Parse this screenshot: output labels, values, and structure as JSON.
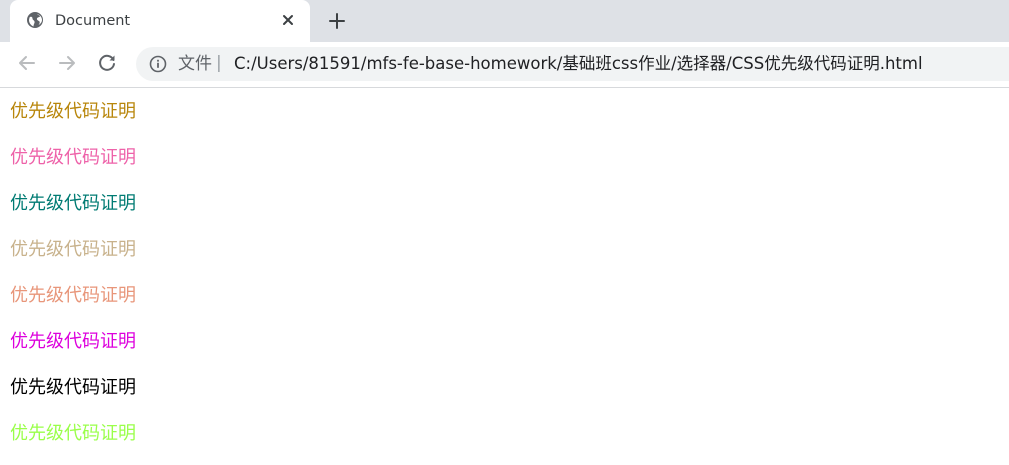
{
  "browser": {
    "tab": {
      "title": "Document",
      "favicon": "globe-icon",
      "close_icon": "close-icon"
    },
    "new_tab_icon": "plus-icon",
    "nav": {
      "back_icon": "arrow-left-icon",
      "forward_icon": "arrow-right-icon",
      "reload_icon": "reload-icon"
    },
    "omnibox": {
      "info_icon": "info-icon",
      "scheme_label": "文件",
      "separator": "|",
      "url": "C:/Users/81591/mfs-fe-base-homework/基础班css作业/选择器/CSS优先级代码证明.html"
    }
  },
  "page": {
    "lines": [
      {
        "text": "优先级代码证明",
        "color": "#b8860b"
      },
      {
        "text": "优先级代码证明",
        "color": "#ee62a9"
      },
      {
        "text": "优先级代码证明",
        "color": "#007b73"
      },
      {
        "text": "优先级代码证明",
        "color": "#c8b28c"
      },
      {
        "text": "优先级代码证明",
        "color": "#e8967a"
      },
      {
        "text": "优先级代码证明",
        "color": "#dd00dd"
      },
      {
        "text": "优先级代码证明",
        "color": "#000000"
      },
      {
        "text": "优先级代码证明",
        "color": "#9aff4a"
      }
    ]
  }
}
